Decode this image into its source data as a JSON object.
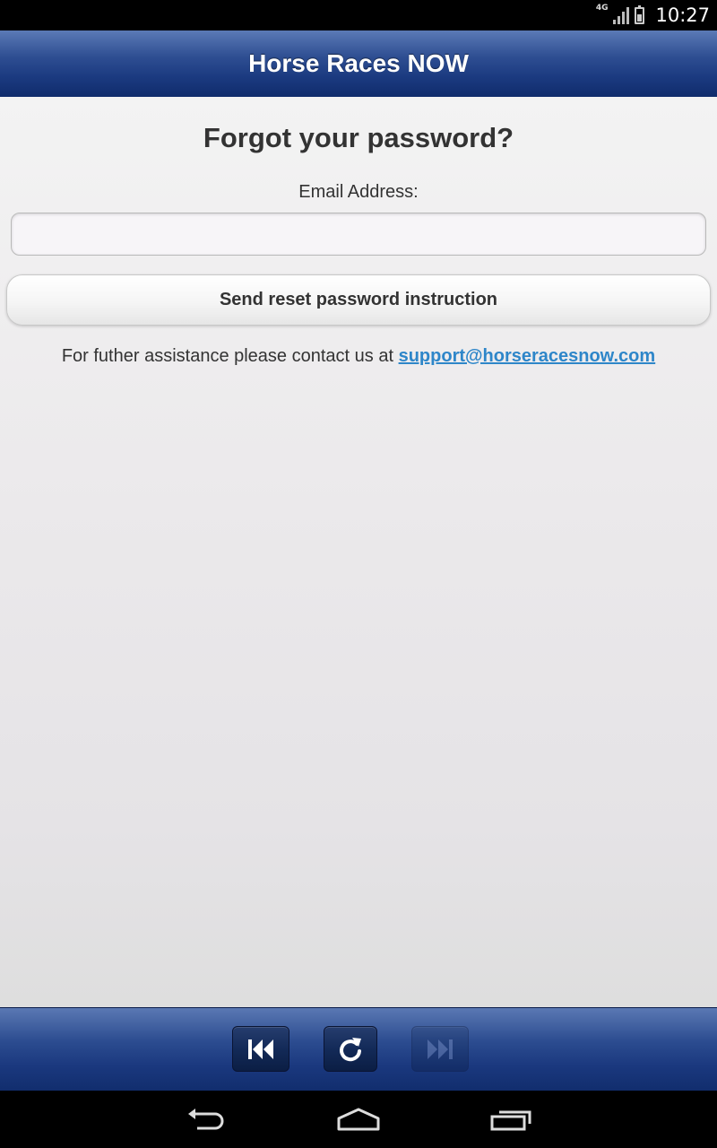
{
  "status_bar": {
    "network_label": "4G",
    "time": "10:27"
  },
  "header": {
    "title": "Horse Races NOW"
  },
  "main": {
    "heading": "Forgot your password?",
    "email_label": "Email Address:",
    "email_value": "",
    "email_placeholder": "",
    "reset_button_label": "Send reset password instruction",
    "assistance_text": "For futher assistance please contact us at ",
    "support_email": "support@horseracesnow.com"
  },
  "toolbar": {
    "buttons": [
      {
        "name": "rewind",
        "icon": "skip-back-icon",
        "enabled": true
      },
      {
        "name": "refresh",
        "icon": "refresh-icon",
        "enabled": true
      },
      {
        "name": "forward",
        "icon": "skip-forward-icon",
        "enabled": false
      }
    ]
  },
  "nav_bar": {
    "icons": [
      "back-icon",
      "home-icon",
      "recent-apps-icon"
    ]
  },
  "colors": {
    "header_blue": "#1b3a80",
    "link_blue": "#2e86c9",
    "text_dark": "#333333"
  }
}
